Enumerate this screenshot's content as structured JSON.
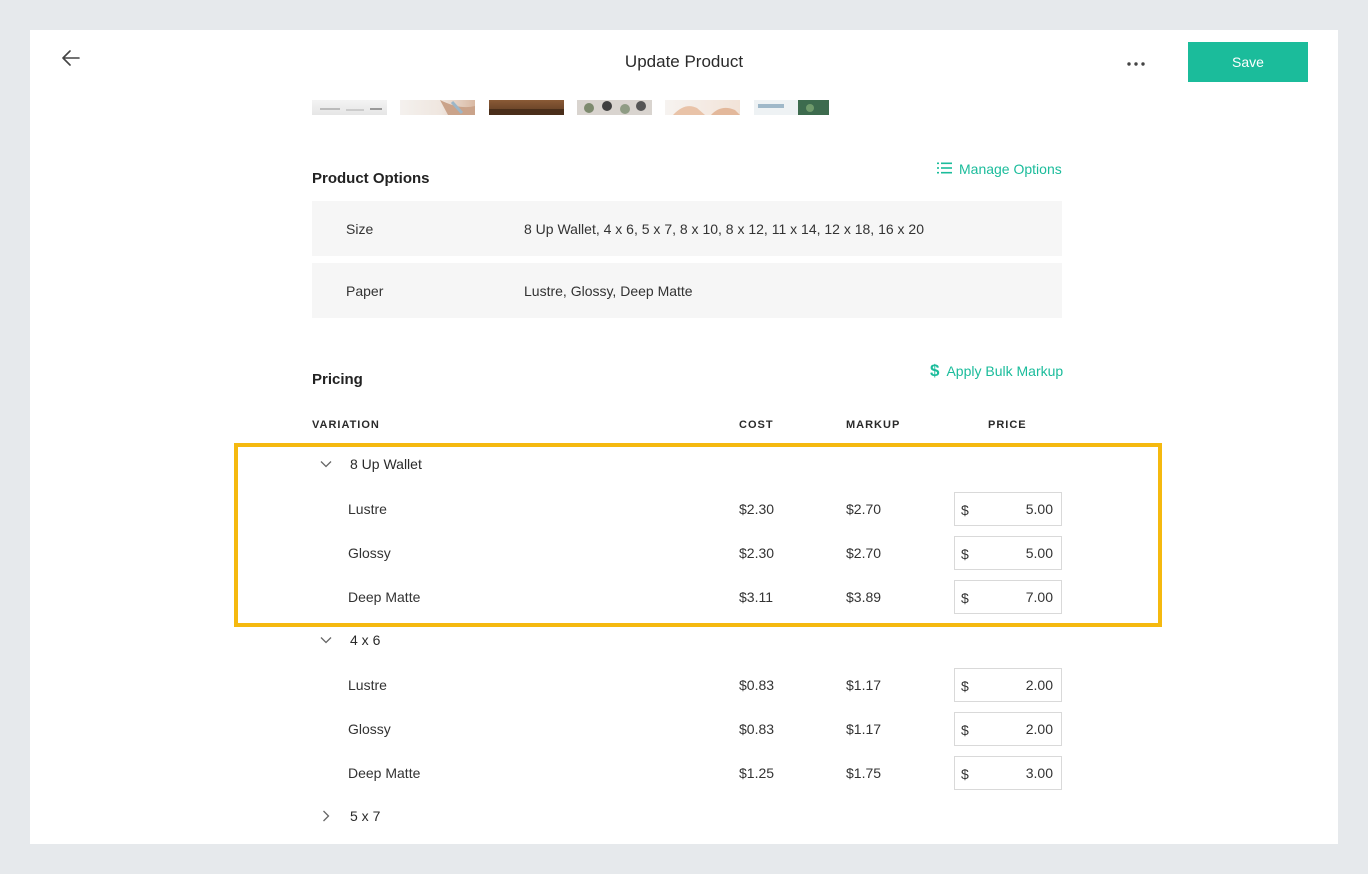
{
  "header": {
    "title": "Update Product",
    "save_label": "Save"
  },
  "product_options": {
    "title": "Product Options",
    "manage_label": "Manage Options",
    "rows": [
      {
        "label": "Size",
        "value": "8 Up Wallet, 4 x 6, 5 x 7, 8 x 10, 8 x 12, 11 x 14, 12 x 18, 16 x 20"
      },
      {
        "label": "Paper",
        "value": "Lustre, Glossy, Deep Matte"
      }
    ]
  },
  "pricing": {
    "title": "Pricing",
    "bulk_label": "Apply Bulk Markup",
    "columns": {
      "variation": "VARIATION",
      "cost": "COST",
      "markup": "MARKUP",
      "price": "PRICE"
    },
    "currency_symbol": "$",
    "groups": [
      {
        "name": "8 Up Wallet",
        "expanded": true,
        "variations": [
          {
            "name": "Lustre",
            "cost": "$2.30",
            "markup": "$2.70",
            "price": "5.00"
          },
          {
            "name": "Glossy",
            "cost": "$2.30",
            "markup": "$2.70",
            "price": "5.00"
          },
          {
            "name": "Deep Matte",
            "cost": "$3.11",
            "markup": "$3.89",
            "price": "7.00"
          }
        ]
      },
      {
        "name": "4 x 6",
        "expanded": true,
        "variations": [
          {
            "name": "Lustre",
            "cost": "$0.83",
            "markup": "$1.17",
            "price": "2.00"
          },
          {
            "name": "Glossy",
            "cost": "$0.83",
            "markup": "$1.17",
            "price": "2.00"
          },
          {
            "name": "Deep Matte",
            "cost": "$1.25",
            "markup": "$1.75",
            "price": "3.00"
          }
        ]
      },
      {
        "name": "5 x 7",
        "expanded": false,
        "variations": []
      }
    ]
  },
  "colors": {
    "accent": "#1bbc9b",
    "highlight": "#f5b90f",
    "background": "#e6e9ec"
  },
  "icons": {
    "back": "arrow-left-icon",
    "more": "more-horizontal-icon",
    "manage": "list-icon",
    "bulk": "dollar-icon",
    "expanded": "chevron-down-icon",
    "collapsed": "chevron-right-icon"
  }
}
